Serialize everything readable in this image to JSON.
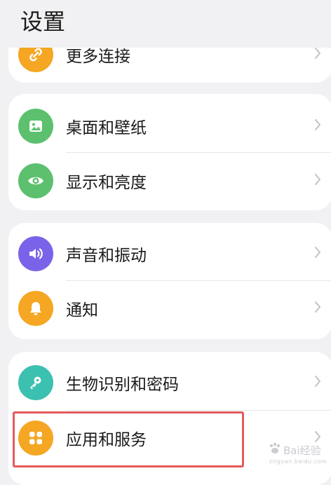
{
  "header": {
    "title": "设置"
  },
  "cards": [
    {
      "items": [
        {
          "label": "更多连接",
          "icon": "link-icon",
          "color": "#f5a623"
        }
      ]
    },
    {
      "items": [
        {
          "label": "桌面和壁纸",
          "icon": "image-icon",
          "color": "#5cc06e"
        },
        {
          "label": "显示和亮度",
          "icon": "eye-icon",
          "color": "#5cc06e"
        }
      ]
    },
    {
      "items": [
        {
          "label": "声音和振动",
          "icon": "speaker-icon",
          "color": "#7a63e8"
        },
        {
          "label": "通知",
          "icon": "bell-icon",
          "color": "#f5a623"
        }
      ]
    },
    {
      "items": [
        {
          "label": "生物识别和密码",
          "icon": "key-icon",
          "color": "#3cc0b0"
        },
        {
          "label": "应用和服务",
          "icon": "apps-grid-icon",
          "color": "#f5a623"
        }
      ]
    }
  ],
  "watermark": {
    "text": "Bai经验",
    "url": "jingyan.baidu.com"
  },
  "colors": {
    "background": "#f1f1f3",
    "card": "#ffffff",
    "highlight": "#e35a5a"
  }
}
